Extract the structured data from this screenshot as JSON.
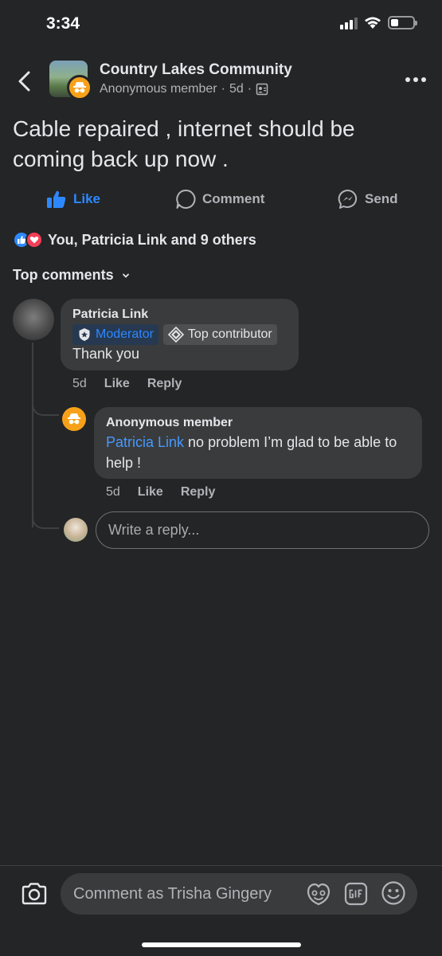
{
  "status_bar": {
    "time": "3:34"
  },
  "header": {
    "group_name": "Country Lakes Community",
    "author": "Anonymous member",
    "time": "5d",
    "separator": "·"
  },
  "post": {
    "text": "Cable repaired , internet should be coming back up now ."
  },
  "actions": {
    "like": "Like",
    "comment": "Comment",
    "send": "Send"
  },
  "reactions": {
    "summary": "You, Patricia Link and 9 others"
  },
  "comments_section": {
    "label": "Top comments"
  },
  "comment": {
    "author": "Patricia Link",
    "badges": {
      "moderator": "Moderator",
      "top_contributor": "Top contributor"
    },
    "text": "Thank you",
    "time": "5d",
    "like": "Like",
    "reply": "Reply"
  },
  "reply": {
    "author": "Anonymous member",
    "mention": "Patricia Link",
    "text": " no problem I’m glad to be able to help !",
    "time": "5d",
    "like": "Like",
    "reply": "Reply"
  },
  "reply_input": {
    "placeholder": "Write a reply..."
  },
  "composer": {
    "placeholder": "Comment as Trisha Gingery"
  },
  "colors": {
    "background": "#242526",
    "accent": "#2d88ff",
    "bubble": "#3a3b3c",
    "anonymous": "#f7a11a"
  },
  "icons": [
    "back-icon",
    "more-icon",
    "like-icon",
    "comment-icon",
    "messenger-icon",
    "camera-icon",
    "sticker-icon",
    "gif-icon",
    "emoji-icon"
  ]
}
